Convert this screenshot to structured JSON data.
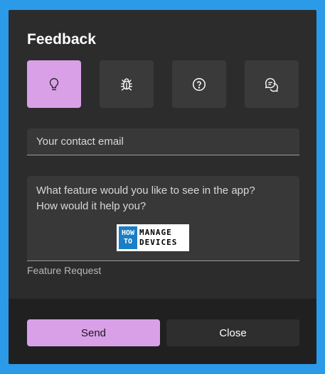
{
  "dialog": {
    "title": "Feedback"
  },
  "feedback_types": [
    {
      "icon": "lightbulb-icon",
      "selected": true
    },
    {
      "icon": "bug-icon",
      "selected": false
    },
    {
      "icon": "question-icon",
      "selected": false
    },
    {
      "icon": "chat-bubbles-icon",
      "selected": false
    }
  ],
  "email": {
    "placeholder": "Your contact email",
    "value": ""
  },
  "description": {
    "placeholder": "What feature would you like to see in the app?\nHow would it help you?",
    "value": "",
    "label": "Feature Request"
  },
  "watermark": {
    "line1_left": "HOW",
    "line2_left": "TO",
    "line1_right": "MANAGE",
    "line2_right": "DEVICES"
  },
  "buttons": {
    "send_label": "Send",
    "close_label": "Close"
  },
  "colors": {
    "accent": "#d9a0e8",
    "dialog_bg": "#2c2c2c",
    "footer_bg": "#202020",
    "page_bg": "#2b9ae8"
  }
}
